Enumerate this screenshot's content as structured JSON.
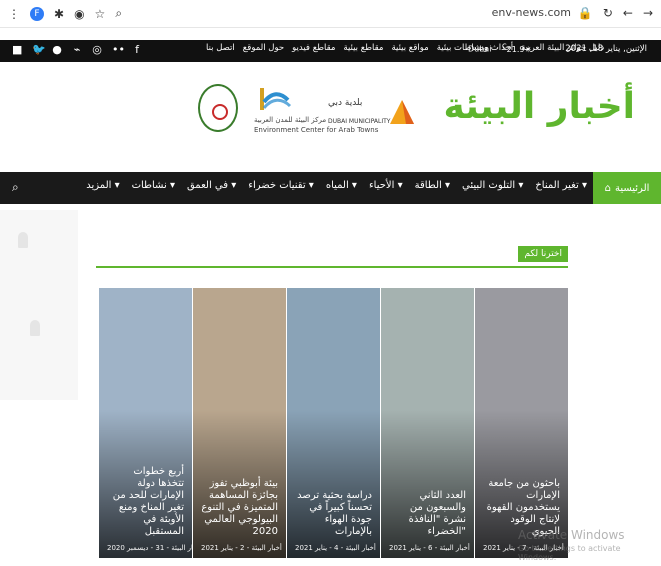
{
  "browser": {
    "url": "env-news.com",
    "profile_letter": "F"
  },
  "topbar": {
    "links": [
      "اتصل بنا",
      "حول الموقع",
      "مقاطع فيديو",
      "مقاطع بيئية",
      "مواقع بيئية",
      "أحداث ونشاطات بيئية",
      "دليل جوائز البيئة العربية"
    ],
    "weather": {
      "city": "Dubai",
      "temp": "21.9",
      "unit": "C"
    },
    "date": "الإثنين, يناير 18, 2021"
  },
  "brand": {
    "logo_text": "أخبار البيئة",
    "partners": {
      "ecat_ar": "مركز البيئة للمدن العربية",
      "ecat_en": "Environment Center for Arab Towns",
      "dubai_ar": "بلدية دبي",
      "dubai_en": "DUBAI MUNICIPALITY"
    }
  },
  "nav": {
    "home": "الرئيسية",
    "items": [
      "تغير المناخ",
      "التلوث البيئي",
      "الطاقة",
      "الأحياء",
      "المياه",
      "تقنيات خضراء",
      "في العمق",
      "نشاطات",
      "المزيد"
    ]
  },
  "section": {
    "label": "اخترنا لكم"
  },
  "cards": [
    {
      "title": "أربع خطوات تتخذها دولة الإمارات للحد من تغير المناخ ومنع الأوبئة في المستقبل",
      "source": "أخبار البيئة",
      "date": "31 - ديسمبر 2020",
      "bg": "#9fb3c7"
    },
    {
      "title": "بيئة أبوظبي تفوز بجائزة المساهمة المتميزة في التنوع البيولوجي العالمي 2020",
      "source": "أخبار البيئة",
      "date": "2 - يناير 2021",
      "bg": "#b9a68e"
    },
    {
      "title": "دراسة بحثية ترصد تحسناً كبيراً في جودة الهواء بالإمارات",
      "source": "أخبار البيئة",
      "date": "4 - يناير 2021",
      "bg": "#8aa3b7"
    },
    {
      "title": "العدد الثاني والسبعون من نشرة \"النافذة الخضراء\"",
      "source": "أخبار البيئة",
      "date": "6 - يناير 2021",
      "bg": "#a5b2b0"
    },
    {
      "title": "باحثون من جامعة الإمارات يستخدمون القهوة لإنتاج الوقود الحيوي",
      "source": "أخبار البيئة",
      "date": "7 - يناير 2021",
      "bg": "#9a9aa0"
    }
  ],
  "os_overlay": {
    "line1": "Activate Windows",
    "line2": "Go to Settings to activate Windows."
  }
}
